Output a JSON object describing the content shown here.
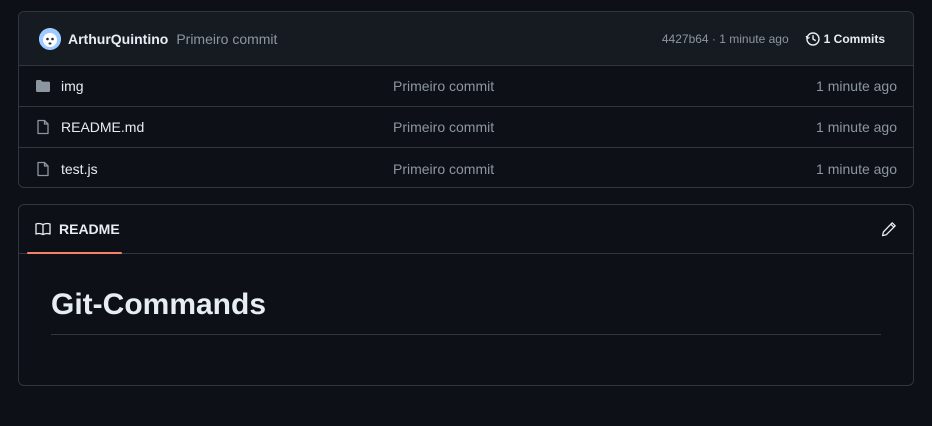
{
  "commit_bar": {
    "author": "ArthurQuintino",
    "message": "Primeiro commit",
    "meta": "4427b64 · 1 minute ago",
    "commits_label": "1 Commits"
  },
  "files": [
    {
      "name": "img",
      "type": "folder",
      "commit": "Primeiro commit",
      "date": "1 minute ago"
    },
    {
      "name": "README.md",
      "type": "file",
      "commit": "Primeiro commit",
      "date": "1 minute ago"
    },
    {
      "name": "test.js",
      "type": "file",
      "commit": "Primeiro commit",
      "date": "1 minute ago"
    }
  ],
  "readme": {
    "tab_label": "README",
    "heading": "Git-Commands"
  },
  "icons": {
    "folder": "folder-icon",
    "file": "file-icon",
    "history": "history-icon",
    "book": "book-icon",
    "edit": "pencil-icon"
  },
  "colors": {
    "background": "#0d1117",
    "border": "#30363d",
    "tab_accent": "#f78166",
    "muted_text": "#8d96a0"
  }
}
